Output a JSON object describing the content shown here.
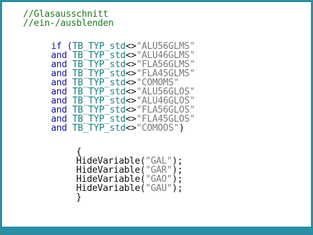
{
  "colors": {
    "frame": "#2a8fa3",
    "comment": "#1f7a1f",
    "keyword": "#1414a6",
    "identifier": "#1a7f7f",
    "string": "#7a7a7a",
    "text": "#111111"
  },
  "code": {
    "comments": [
      "//Glasausschnitt",
      "//ein-/ausblenden"
    ],
    "conditions": [
      {
        "keyword": "if (",
        "ident": "TB_TYP_std",
        "op": "<>",
        "value": "\"ALU56GLMS\"",
        "suffix": ""
      },
      {
        "keyword": "and ",
        "ident": "TB_TYP_std",
        "op": "<>",
        "value": "\"ALU46GLMS\"",
        "suffix": ""
      },
      {
        "keyword": "and ",
        "ident": "TB_TYP_std",
        "op": "<>",
        "value": "\"FLA56GLMS\"",
        "suffix": ""
      },
      {
        "keyword": "and ",
        "ident": "TB_TYP_std",
        "op": "<>",
        "value": "\"FLA45GLMS\"",
        "suffix": ""
      },
      {
        "keyword": "and ",
        "ident": "TB_TYP_std",
        "op": "<>",
        "value": "\"COMOMS\"",
        "suffix": ""
      },
      {
        "keyword": "and ",
        "ident": "TB_TYP_std",
        "op": "<>",
        "value": "\"ALU56GLOS\"",
        "suffix": ""
      },
      {
        "keyword": "and ",
        "ident": "TB_TYP_std",
        "op": "<>",
        "value": "\"ALU46GLOS\"",
        "suffix": ""
      },
      {
        "keyword": "and ",
        "ident": "TB_TYP_std",
        "op": "<>",
        "value": "\"FLA56GLOS\"",
        "suffix": ""
      },
      {
        "keyword": "and ",
        "ident": "TB_TYP_std",
        "op": "<>",
        "value": "\"FLA45GLOS\"",
        "suffix": ""
      },
      {
        "keyword": "and ",
        "ident": "TB_TYP_std",
        "op": "<>",
        "value": "\"COMOOS\"",
        "suffix": ")"
      }
    ],
    "open_brace": "{",
    "calls": [
      {
        "func": "HideVariable(",
        "arg": "\"GAL\"",
        "end": ");"
      },
      {
        "func": "HideVariable(",
        "arg": "\"GAR\"",
        "end": ");"
      },
      {
        "func": "HideVariable(",
        "arg": "\"GAO\"",
        "end": ");"
      },
      {
        "func": "HideVariable(",
        "arg": "\"GAU\"",
        "end": ");"
      }
    ],
    "close_brace": "}"
  }
}
